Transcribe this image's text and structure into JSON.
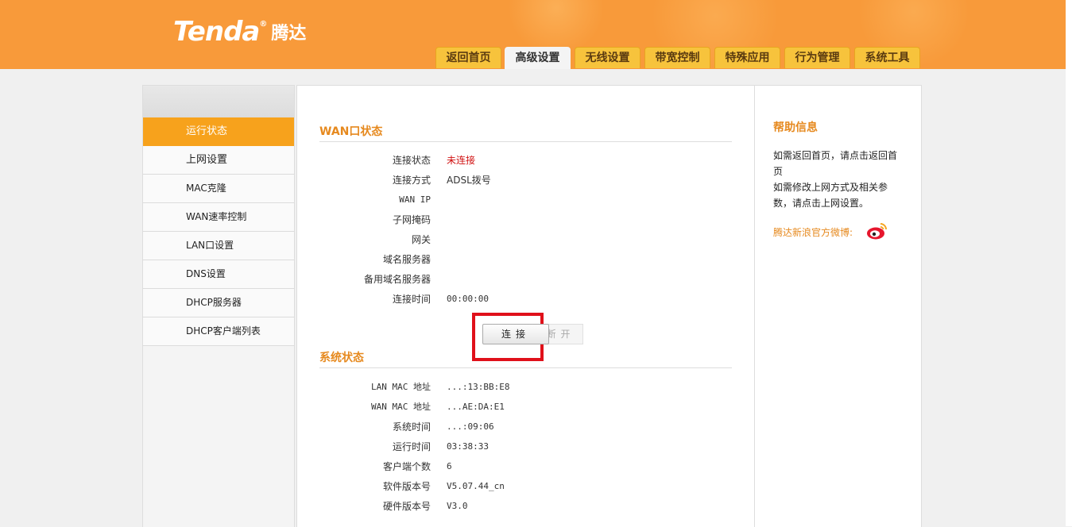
{
  "header": {
    "logo_text": "Tenda",
    "logo_reg": "®",
    "logo_cn": "腾达",
    "tabs": [
      "返回首页",
      "高级设置",
      "无线设置",
      "带宽控制",
      "特殊应用",
      "行为管理",
      "系统工具"
    ],
    "active_tab": "高级设置"
  },
  "sidebar": {
    "items": [
      "运行状态",
      "上网设置",
      "MAC克隆",
      "WAN速率控制",
      "LAN口设置",
      "DNS设置",
      "DHCP服务器",
      "DHCP客户端列表"
    ],
    "active": "运行状态"
  },
  "wan": {
    "title": "WAN口状态",
    "rows": [
      {
        "label": "连接状态",
        "value": "未连接"
      },
      {
        "label": "连接方式",
        "value": "ADSL拨号"
      },
      {
        "label": "WAN IP",
        "value": ""
      },
      {
        "label": "子网掩码",
        "value": ""
      },
      {
        "label": "网关",
        "value": ""
      },
      {
        "label": "域名服务器",
        "value": ""
      },
      {
        "label": "备用域名服务器",
        "value": ""
      },
      {
        "label": "连接时间",
        "value": "00:00:00"
      }
    ],
    "connect_label": "连接",
    "disconnect_label": "断开"
  },
  "system": {
    "title": "系统状态",
    "rows": [
      {
        "label": "LAN MAC 地址",
        "value": "...:13:BB:E8"
      },
      {
        "label": "WAN MAC 地址",
        "value": "...AE:DA:E1"
      },
      {
        "label": "系统时间",
        "value": "...:09:06"
      },
      {
        "label": "运行时间",
        "value": "03:38:33"
      },
      {
        "label": "客户端个数",
        "value": "6"
      },
      {
        "label": "软件版本号",
        "value": "V5.07.44_cn"
      },
      {
        "label": "硬件版本号",
        "value": "V3.0"
      }
    ]
  },
  "help": {
    "title": "帮助信息",
    "line1": "如需返回首页，请点击返回首页",
    "line2": "如需修改上网方式及相关参数，请点击上网设置。",
    "weibo": "腾达新浪官方微博:"
  },
  "colors": {
    "header_bg": "#f89a3a",
    "tab_bg": "#f7c33c",
    "accent": "#e6891e",
    "nav_active": "#f7a21c",
    "error": "#d01010"
  }
}
